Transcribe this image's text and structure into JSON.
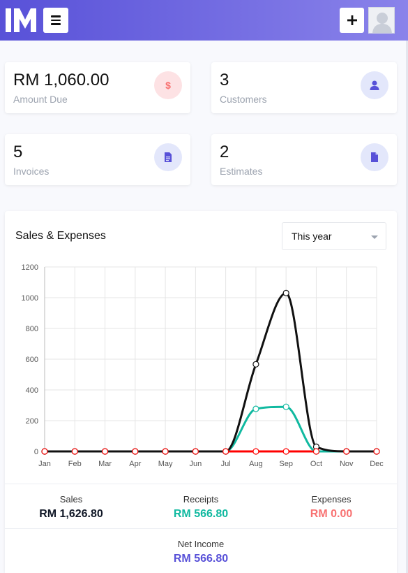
{
  "header": {
    "logo_text": "IM",
    "menu_icon": "hamburger-icon",
    "add_icon": "plus-icon",
    "avatar_icon": "user-avatar-icon",
    "gradient": [
      "#5851d8",
      "#8a83ea"
    ]
  },
  "stats": [
    {
      "value": "RM 1,060.00",
      "label": "Amount Due",
      "icon": "dollar-icon",
      "accent": "#f87171"
    },
    {
      "value": "3",
      "label": "Customers",
      "icon": "user-icon",
      "accent": "#5851d8"
    },
    {
      "value": "5",
      "label": "Invoices",
      "icon": "invoice-icon",
      "accent": "#5851d8"
    },
    {
      "value": "2",
      "label": "Estimates",
      "icon": "document-icon",
      "accent": "#5851d8"
    }
  ],
  "chart_section": {
    "title": "Sales & Expenses",
    "range_select": "This year"
  },
  "chart_data": {
    "type": "line",
    "categories": [
      "Jan",
      "Feb",
      "Mar",
      "Apr",
      "May",
      "Jun",
      "Jul",
      "Aug",
      "Sep",
      "Oct",
      "Nov",
      "Dec"
    ],
    "ylim": [
      0,
      1200
    ],
    "yticks": [
      0,
      200,
      400,
      600,
      800,
      1000,
      1200
    ],
    "grid": true,
    "series": [
      {
        "key": "sales",
        "color": "#111111",
        "values": [
          0,
          0,
          0,
          0,
          0,
          0,
          0,
          566.8,
          1030,
          30,
          0,
          0
        ]
      },
      {
        "key": "receipts",
        "color": "#10b9a0",
        "values": [
          0,
          0,
          0,
          0,
          0,
          0,
          0,
          276.8,
          290,
          0,
          0,
          0
        ]
      },
      {
        "key": "expenses",
        "color": "#ff0000",
        "values": [
          0,
          0,
          0,
          0,
          0,
          0,
          0,
          0,
          0,
          0,
          0,
          0
        ]
      }
    ]
  },
  "summary": {
    "sales_label": "Sales",
    "sales_value": "RM 1,626.80",
    "receipts_label": "Receipts",
    "receipts_value": "RM 566.80",
    "expenses_label": "Expenses",
    "expenses_value": "RM 0.00",
    "net_label": "Net Income",
    "net_value": "RM 566.80",
    "colors": {
      "sales": "#111827",
      "receipts": "#10b9a0",
      "expenses": "#f87171",
      "net": "#5851d8"
    }
  }
}
